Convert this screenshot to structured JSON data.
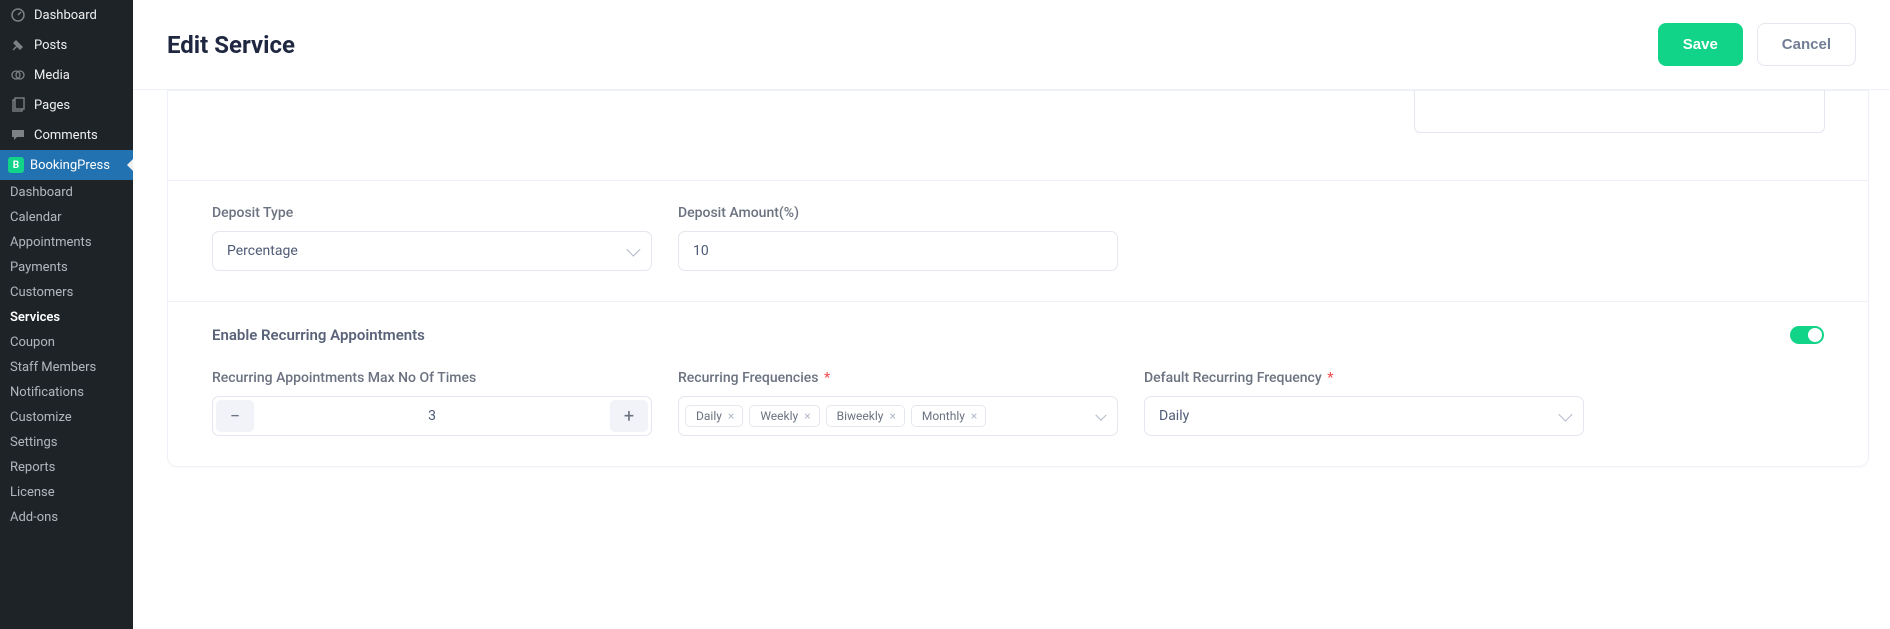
{
  "sidebar": {
    "wp_items": [
      {
        "icon": "dashboard",
        "label": "Dashboard"
      },
      {
        "icon": "pin",
        "label": "Posts"
      },
      {
        "icon": "media",
        "label": "Media"
      },
      {
        "icon": "pages",
        "label": "Pages"
      },
      {
        "icon": "comment",
        "label": "Comments"
      }
    ],
    "active_plugin": {
      "label": "BookingPress"
    },
    "submenu": [
      {
        "label": "Dashboard"
      },
      {
        "label": "Calendar"
      },
      {
        "label": "Appointments"
      },
      {
        "label": "Payments"
      },
      {
        "label": "Customers"
      },
      {
        "label": "Services",
        "current": true
      },
      {
        "label": "Coupon"
      },
      {
        "label": "Staff Members"
      },
      {
        "label": "Notifications"
      },
      {
        "label": "Customize"
      },
      {
        "label": "Settings"
      },
      {
        "label": "Reports"
      },
      {
        "label": "License"
      },
      {
        "label": "Add-ons"
      }
    ]
  },
  "header": {
    "title": "Edit Service",
    "save_label": "Save",
    "cancel_label": "Cancel"
  },
  "deposit": {
    "type_label": "Deposit Type",
    "type_value": "Percentage",
    "amount_label": "Deposit Amount(%)",
    "amount_value": "10"
  },
  "recurring": {
    "enable_label": "Enable Recurring Appointments",
    "enable_value": true,
    "max_label": "Recurring Appointments Max No Of Times",
    "max_value": "3",
    "freq_label": "Recurring Frequencies",
    "freq_tags": [
      "Daily",
      "Weekly",
      "Biweekly",
      "Monthly"
    ],
    "default_label": "Default Recurring Frequency",
    "default_value": "Daily"
  },
  "glyphs": {
    "minus": "−",
    "plus": "+",
    "x": "×"
  }
}
